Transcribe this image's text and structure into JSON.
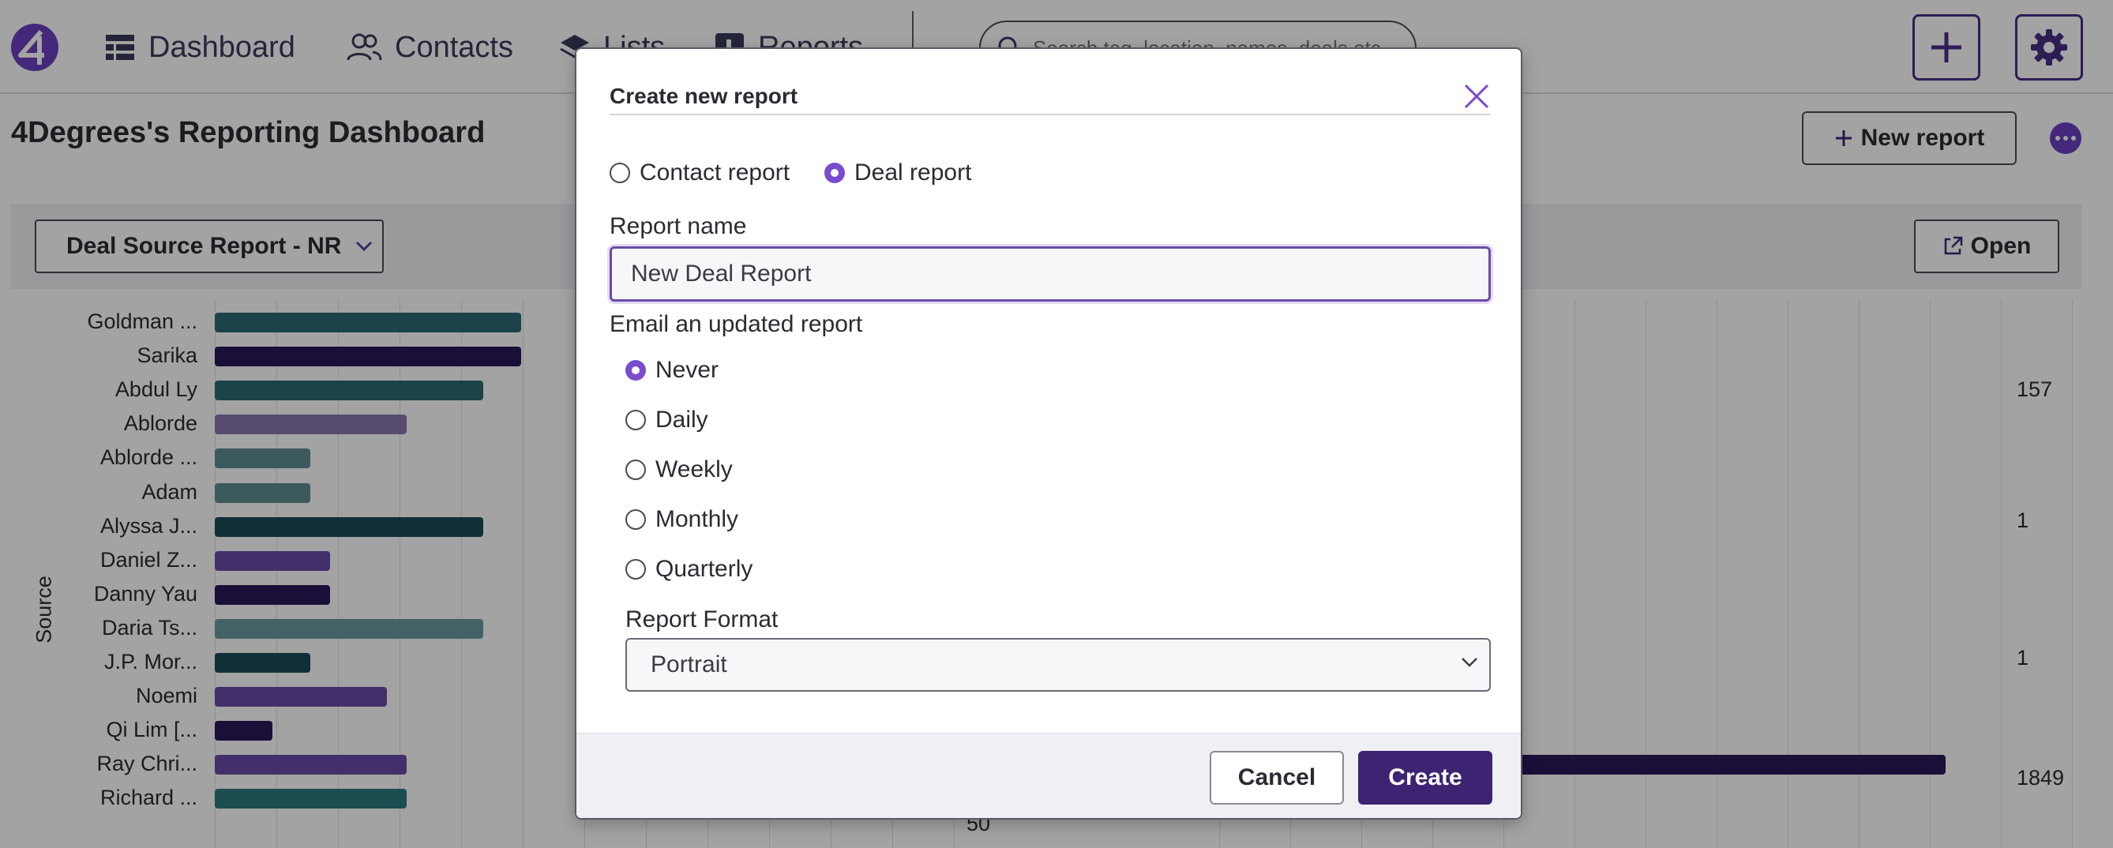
{
  "nav": {
    "items": [
      {
        "label": "Dashboard",
        "icon": "grid-icon"
      },
      {
        "label": "Contacts",
        "icon": "people-icon"
      },
      {
        "label": "Lists",
        "icon": "layers-icon"
      },
      {
        "label": "Reports",
        "icon": "report-icon"
      }
    ],
    "search_placeholder": "Search tag, location, names, deals etc"
  },
  "page": {
    "title": "4Degrees's Reporting Dashboard",
    "new_report_label": "New report"
  },
  "panel": {
    "selected_report": "Deal Source Report - NR",
    "open_label": "Open"
  },
  "chart_data": {
    "type": "bar",
    "orientation": "horizontal",
    "ylabel": "Source",
    "categories": [
      "Goldman ...",
      "Sarika",
      "Abdul Ly",
      "Ablorde",
      "Ablorde ...",
      "Adam",
      "Alyssa J...",
      "Daniel Z...",
      "Danny Yau",
      "Daria Ts...",
      "J.P. Mor...",
      "Noemi",
      "Qi Lim [...",
      "Ray Chri...",
      "Richard ..."
    ],
    "values": [
      8,
      8,
      7,
      5,
      2.5,
      2.5,
      7,
      3,
      3,
      7,
      2.5,
      4.5,
      1.5,
      5,
      5
    ],
    "colors": [
      "#2d6a73",
      "#2a1858",
      "#2d6a73",
      "#8877b0",
      "#5e8c90",
      "#5e8c90",
      "#1c4a55",
      "#6a4ca6",
      "#2a1858",
      "#6a9a9e",
      "#1c4a55",
      "#6a4ca6",
      "#2a1858",
      "#6a4ca6",
      "#2d7a7f"
    ],
    "visible_tick": "50",
    "right_values": [
      "157",
      "1",
      "1",
      "1849"
    ],
    "grid": true
  },
  "modal": {
    "title": "Create new report",
    "report_types": [
      {
        "label": "Contact report",
        "checked": false
      },
      {
        "label": "Deal report",
        "checked": true
      }
    ],
    "name_label": "Report name",
    "name_value": "New Deal Report",
    "email_label": "Email an updated report",
    "frequencies": [
      {
        "label": "Never",
        "checked": true
      },
      {
        "label": "Daily",
        "checked": false
      },
      {
        "label": "Weekly",
        "checked": false
      },
      {
        "label": "Monthly",
        "checked": false
      },
      {
        "label": "Quarterly",
        "checked": false
      }
    ],
    "format_label": "Report Format",
    "format_value": "Portrait",
    "cancel_label": "Cancel",
    "create_label": "Create"
  },
  "colors": {
    "accent": "#7a4cd0",
    "primary_dark": "#3d2472"
  }
}
